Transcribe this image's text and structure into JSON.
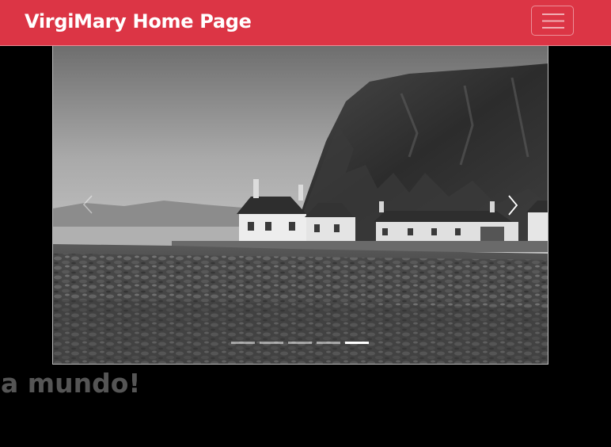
{
  "navbar": {
    "brand": "VirgiMary Home Page",
    "toggler_icon": "hamburger-icon",
    "background_color": "#dc3545"
  },
  "carousel": {
    "prev_icon": "chevron-left-icon",
    "next_icon": "chevron-right-icon",
    "indicator_count": 5,
    "active_indicator": 5,
    "photo_subject": "white cottages below a rocky cliff by the sea (black and white photo)"
  },
  "main": {
    "heading": "a mundo!",
    "heading_color": "#555555"
  },
  "page": {
    "background_color": "#000000"
  }
}
